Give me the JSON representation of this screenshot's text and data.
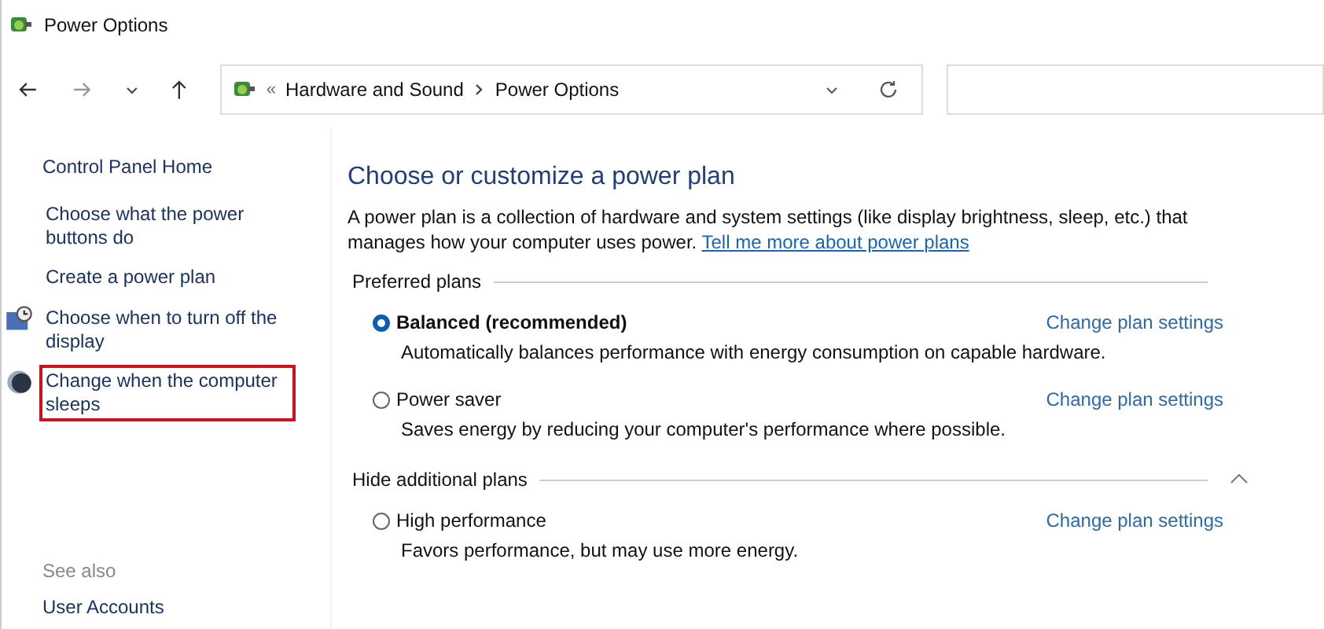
{
  "window": {
    "title": "Power Options"
  },
  "address_bar": {
    "overflow": "«",
    "crumbs": [
      "Hardware and Sound",
      "Power Options"
    ]
  },
  "sidebar": {
    "home": "Control Panel Home",
    "items": [
      {
        "label": "Choose what the power buttons do",
        "kind": "plain",
        "highlighted": false
      },
      {
        "label": "Create a power plan",
        "kind": "plain",
        "highlighted": false
      },
      {
        "label": "Choose when to turn off the display",
        "kind": "display",
        "highlighted": false
      },
      {
        "label": "Change when the computer sleeps",
        "kind": "sleep",
        "highlighted": true
      }
    ],
    "see_also": {
      "heading": "See also",
      "links": [
        "User Accounts"
      ]
    }
  },
  "main": {
    "title": "Choose or customize a power plan",
    "intro": "A power plan is a collection of hardware and system settings (like display brightness, sleep, etc.) that manages how your computer uses power.",
    "intro_link": "Tell me more about power plans",
    "groups": [
      {
        "label": "Preferred plans",
        "plans": [
          {
            "name": "Balanced (recommended)",
            "selected": true,
            "description": "Automatically balances performance with energy consumption on capable hardware.",
            "link": "Change plan settings"
          },
          {
            "name": "Power saver",
            "selected": false,
            "description": "Saves energy by reducing your computer's performance where possible.",
            "link": "Change plan settings"
          }
        ]
      },
      {
        "label": "Hide additional plans",
        "expanded": true,
        "plans": [
          {
            "name": "High performance",
            "selected": false,
            "description": "Favors performance, but may use more energy.",
            "link": "Change plan settings"
          }
        ]
      }
    ]
  }
}
